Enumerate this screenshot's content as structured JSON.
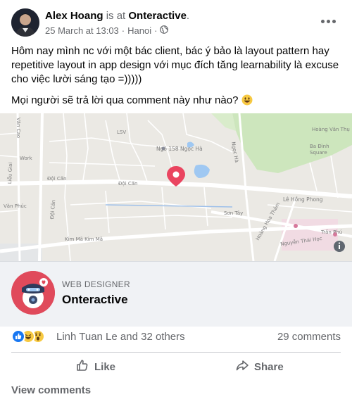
{
  "post": {
    "author": "Alex Hoang",
    "is_at": "is at",
    "location_tag": "Onteractive",
    "location_dot": ".",
    "date": "25 March at 13:03",
    "separator": "·",
    "place": "Hanoi",
    "separator2": "·",
    "privacy_icon": "globe-icon",
    "more_icon": "more-options-icon",
    "text_paragraph_1": "Hôm nay mình nc với một bác client, bác ý bảo là layout pattern hay repetitive layout in app design với mục đích tăng learnability là excuse cho việc lười sáng tạo =)))))",
    "text_paragraph_2": "Mọi người sẽ trả lời qua comment này như nào?"
  },
  "map": {
    "labels": {
      "van_cao": "Văn Cao",
      "lieu_giai": "Liễu Giai",
      "work": "Work",
      "lsv": "LSV",
      "ngo_158": "Ngõ 158 Ngọc Hà",
      "doi_can_1": "Đội Cấn",
      "doi_can_2": "Đội Cấn",
      "doi_can_3": "Đội Cấn",
      "van_phuc": "Văn Phúc",
      "ngoc_ha": "Ngọc Hà",
      "hoang_van_thu": "Hoàng Văn Thụ",
      "ba_dinh_square": "Ba Đình Square",
      "le_hong_phong": "Lê Hồng Phong",
      "son_tay": "Sơn Tây",
      "kim_ma": "Kim Mã Kim Mã",
      "nguyen_thai_hoc": "Nguyễn Thái Học",
      "tran_phu": "Trần Phú",
      "hoang_hoa_tham": "Hoàng Hoa Thám"
    },
    "pin_icon": "location-pin-icon",
    "info_icon": "map-info-icon",
    "colors": {
      "pin": "#ea4560",
      "park": "#cde6bd",
      "water": "#9fc8f2"
    }
  },
  "page": {
    "category": "WEB DESIGNER",
    "name": "Onteractive",
    "avatar_icon": "robot-mascot-icon",
    "accent": "#e04a5b"
  },
  "reactions": {
    "icons": [
      "like-reaction-icon",
      "haha-reaction-icon",
      "wow-reaction-icon"
    ],
    "names": "Linh Tuan Le and 32 others",
    "comments": "29 comments"
  },
  "actions": {
    "like_label": "Like",
    "share_label": "Share",
    "like_icon": "thumbs-up-icon",
    "share_icon": "share-arrow-icon"
  },
  "footer": {
    "view_comments": "View comments"
  }
}
